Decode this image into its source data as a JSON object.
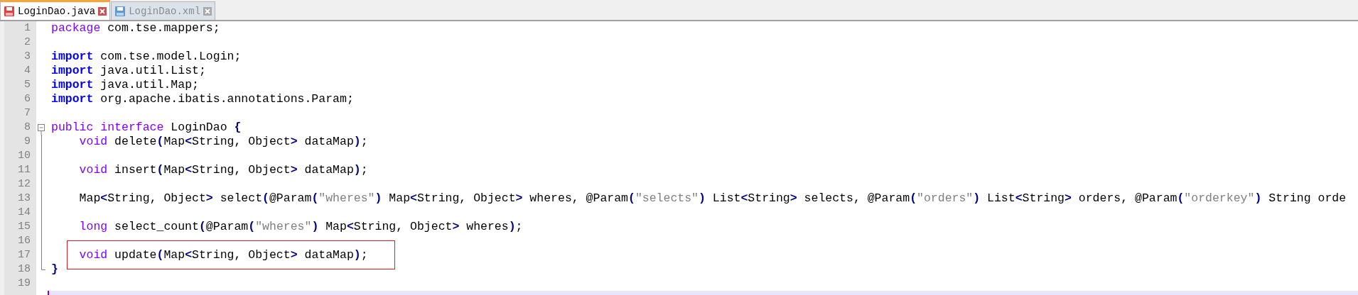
{
  "tabs": [
    {
      "label": "LoginDao.java",
      "selected": true
    },
    {
      "label": "LoginDao.xml",
      "selected": false
    }
  ],
  "editor": {
    "lines": [
      {
        "number": "1",
        "boxed": false,
        "current": false,
        "tokens": [
          {
            "kind": "keyword",
            "text": "package"
          },
          {
            "kind": "plain",
            "text": " com.tse.mappers;"
          }
        ]
      },
      {
        "number": "2",
        "boxed": false,
        "current": false
      },
      {
        "number": "3",
        "boxed": false,
        "current": false,
        "tokens": [
          {
            "kind": "import",
            "text": "import"
          },
          {
            "kind": "plain",
            "text": " com.tse.model.Login;"
          }
        ]
      },
      {
        "number": "4",
        "boxed": false,
        "current": false,
        "tokens": [
          {
            "kind": "import",
            "text": "import"
          },
          {
            "kind": "plain",
            "text": " java.util.List;"
          }
        ]
      },
      {
        "number": "5",
        "boxed": false,
        "current": false,
        "tokens": [
          {
            "kind": "import",
            "text": "import"
          },
          {
            "kind": "plain",
            "text": " java.util.Map;"
          }
        ]
      },
      {
        "number": "6",
        "boxed": false,
        "current": false,
        "tokens": [
          {
            "kind": "import",
            "text": "import"
          },
          {
            "kind": "plain",
            "text": " org.apache.ibatis.annotations.Param;"
          }
        ]
      },
      {
        "number": "7",
        "boxed": false,
        "current": false
      },
      {
        "number": "8",
        "boxed": false,
        "current": false,
        "tokens": [
          {
            "kind": "keyword",
            "text": "public interface"
          },
          {
            "kind": "plain",
            "text": " LoginDao "
          },
          {
            "kind": "operator",
            "text": "{"
          }
        ],
        "children": [
          {
            "number": "9",
            "boxed": false,
            "current": false,
            "tokens": [
              {
                "kind": "keyword",
                "text": "void"
              },
              {
                "kind": "plain",
                "text": " delete"
              },
              {
                "kind": "operator",
                "text": "("
              },
              {
                "kind": "plain",
                "text": "Map"
              },
              {
                "kind": "operator",
                "text": "<"
              },
              {
                "kind": "plain",
                "text": "String, Object"
              },
              {
                "kind": "operator",
                "text": ">"
              },
              {
                "kind": "plain",
                "text": " dataMap"
              },
              {
                "kind": "operator",
                "text": ")"
              },
              {
                "kind": "plain",
                "text": ";"
              }
            ]
          },
          {
            "number": "10",
            "boxed": false,
            "current": false
          },
          {
            "number": "11",
            "boxed": false,
            "current": false,
            "tokens": [
              {
                "kind": "keyword",
                "text": "void"
              },
              {
                "kind": "plain",
                "text": " insert"
              },
              {
                "kind": "operator",
                "text": "("
              },
              {
                "kind": "plain",
                "text": "Map"
              },
              {
                "kind": "operator",
                "text": "<"
              },
              {
                "kind": "plain",
                "text": "String, Object"
              },
              {
                "kind": "operator",
                "text": ">"
              },
              {
                "kind": "plain",
                "text": " dataMap"
              },
              {
                "kind": "operator",
                "text": ")"
              },
              {
                "kind": "plain",
                "text": ";"
              }
            ]
          },
          {
            "number": "12",
            "boxed": false,
            "current": false
          },
          {
            "number": "13",
            "boxed": false,
            "current": false,
            "tokens": [
              {
                "kind": "plain",
                "text": "Map"
              },
              {
                "kind": "operator",
                "text": "<"
              },
              {
                "kind": "plain",
                "text": "String, Object"
              },
              {
                "kind": "operator",
                "text": ">"
              },
              {
                "kind": "plain",
                "text": " select"
              },
              {
                "kind": "operator",
                "text": "("
              },
              {
                "kind": "plain",
                "text": "@Param"
              },
              {
                "kind": "operator",
                "text": "("
              },
              {
                "kind": "string",
                "text": "\"wheres\""
              },
              {
                "kind": "operator",
                "text": ")"
              },
              {
                "kind": "plain",
                "text": " Map"
              },
              {
                "kind": "operator",
                "text": "<"
              },
              {
                "kind": "plain",
                "text": "String, Object"
              },
              {
                "kind": "operator",
                "text": ">"
              },
              {
                "kind": "plain",
                "text": " wheres, @Param"
              },
              {
                "kind": "operator",
                "text": "("
              },
              {
                "kind": "string",
                "text": "\"selects\""
              },
              {
                "kind": "operator",
                "text": ")"
              },
              {
                "kind": "plain",
                "text": " List"
              },
              {
                "kind": "operator",
                "text": "<"
              },
              {
                "kind": "plain",
                "text": "String"
              },
              {
                "kind": "operator",
                "text": ">"
              },
              {
                "kind": "plain",
                "text": " selects, @Param"
              },
              {
                "kind": "operator",
                "text": "("
              },
              {
                "kind": "string",
                "text": "\"orders\""
              },
              {
                "kind": "operator",
                "text": ")"
              },
              {
                "kind": "plain",
                "text": " List"
              },
              {
                "kind": "operator",
                "text": "<"
              },
              {
                "kind": "plain",
                "text": "String"
              },
              {
                "kind": "operator",
                "text": ">"
              },
              {
                "kind": "plain",
                "text": " orders, @Param"
              },
              {
                "kind": "operator",
                "text": "("
              },
              {
                "kind": "string",
                "text": "\"orderkey\""
              },
              {
                "kind": "operator",
                "text": ")"
              },
              {
                "kind": "plain",
                "text": " String orde"
              }
            ]
          },
          {
            "number": "14",
            "boxed": false,
            "current": false
          },
          {
            "number": "15",
            "boxed": false,
            "current": false,
            "tokens": [
              {
                "kind": "keyword",
                "text": "long"
              },
              {
                "kind": "plain",
                "text": " select_count"
              },
              {
                "kind": "operator",
                "text": "("
              },
              {
                "kind": "plain",
                "text": "@Param"
              },
              {
                "kind": "operator",
                "text": "("
              },
              {
                "kind": "string",
                "text": "\"wheres\""
              },
              {
                "kind": "operator",
                "text": ")"
              },
              {
                "kind": "plain",
                "text": " Map"
              },
              {
                "kind": "operator",
                "text": "<"
              },
              {
                "kind": "plain",
                "text": "String, Object"
              },
              {
                "kind": "operator",
                "text": ">"
              },
              {
                "kind": "plain",
                "text": " wheres"
              },
              {
                "kind": "operator",
                "text": ")"
              },
              {
                "kind": "plain",
                "text": ";"
              }
            ]
          },
          {
            "number": "16",
            "boxed": false,
            "current": false
          },
          {
            "number": "17",
            "boxed": true,
            "current": false,
            "tokens": [
              {
                "kind": "keyword",
                "text": "void"
              },
              {
                "kind": "plain",
                "text": " update"
              },
              {
                "kind": "operator",
                "text": "("
              },
              {
                "kind": "plain",
                "text": "Map"
              },
              {
                "kind": "operator",
                "text": "<"
              },
              {
                "kind": "plain",
                "text": "String, Object"
              },
              {
                "kind": "operator",
                "text": ">"
              },
              {
                "kind": "plain",
                "text": " dataMap"
              },
              {
                "kind": "operator",
                "text": ")"
              },
              {
                "kind": "plain",
                "text": ";"
              }
            ]
          }
        ]
      },
      {
        "number": "18",
        "boxed": false,
        "current": false,
        "tokens": [
          {
            "kind": "operator",
            "text": "}"
          }
        ]
      },
      {
        "number": "19",
        "boxed": false,
        "current": false
      },
      {
        "boxed": false,
        "current": true
      }
    ]
  }
}
